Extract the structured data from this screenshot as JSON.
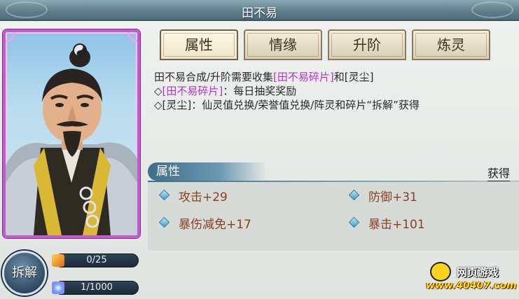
{
  "header": {
    "title": "田不易"
  },
  "tabs": [
    {
      "label": "属性",
      "active": true
    },
    {
      "label": "情缘",
      "active": false
    },
    {
      "label": "升阶",
      "active": false
    },
    {
      "label": "炼灵",
      "active": false
    }
  ],
  "description": {
    "line1_prefix": "田不易合成/升阶需要收集",
    "line1_item": "[田不易碎片]",
    "line1_mid": "和",
    "line1_suffix": "[灵尘]",
    "line2_bullet": "◇",
    "line2_item": "[田不易碎片]",
    "line2_text": "：每日抽奖奖励",
    "line3_bullet": "◇",
    "line3_text": "[灵尘]：仙灵值兑换/荣誉值兑换/阵灵和碎片“拆解”获得"
  },
  "attributes": {
    "header": "属性",
    "obtain_label": "获得",
    "stats": [
      {
        "label": "攻击+29"
      },
      {
        "label": "防御+31"
      },
      {
        "label": "暴伤减免+17"
      },
      {
        "label": "暴击+101"
      }
    ]
  },
  "actions": {
    "disassemble_label": "拆解"
  },
  "resources": {
    "fragments": "0/25",
    "dust": "1/1000"
  },
  "watermark": {
    "name": "网页游戏",
    "url": "www.40407.com"
  },
  "colors": {
    "accent_purple": "#b233c8",
    "stat_text": "#8a3f1f",
    "card_border": "#c35ad0"
  }
}
